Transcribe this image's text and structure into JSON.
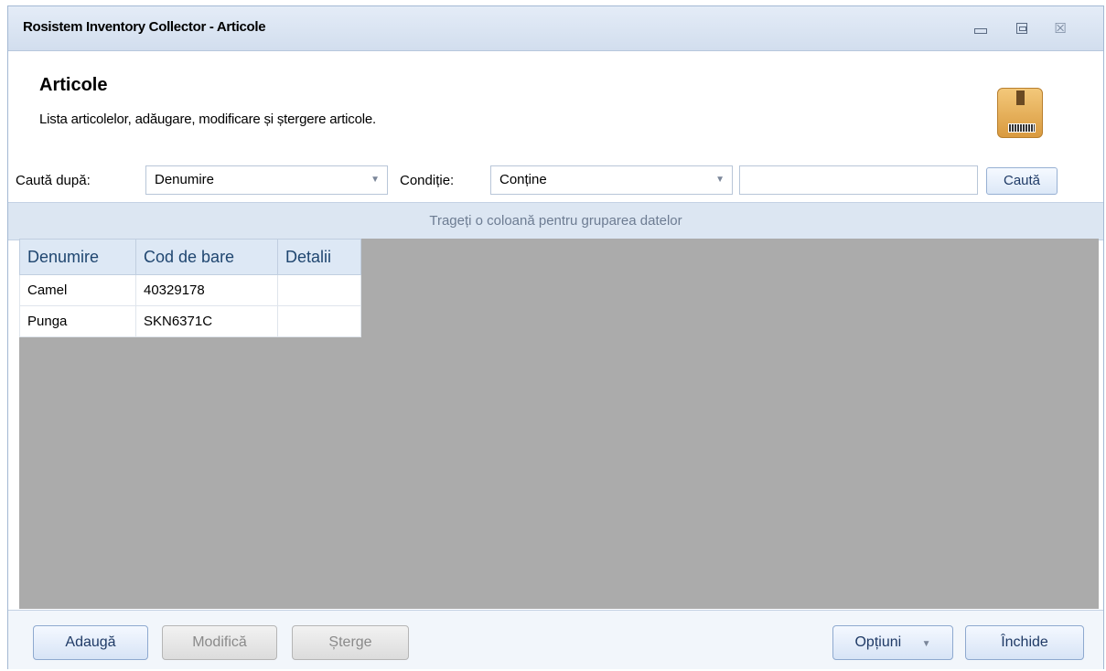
{
  "window": {
    "title": "Rosistem Inventory Collector - Articole",
    "controls": {
      "minimize_icon": "minimize-icon",
      "maximize_icon": "maximize-icon",
      "close_glyph": "☒"
    }
  },
  "header": {
    "title": "Articole",
    "subtitle": "Lista articolelor, adăugare, modificare și ștergere articole.",
    "icon": "package-icon"
  },
  "search": {
    "search_by_label": "Caută după:",
    "search_by_value": "Denumire",
    "condition_label": "Condiție:",
    "condition_value": "Conține",
    "text_value": "",
    "button_label": "Caută"
  },
  "grid": {
    "group_hint": "Trageți o coloană pentru gruparea datelor",
    "columns": [
      "Denumire",
      "Cod de bare",
      "Detalii"
    ],
    "rows": [
      [
        "Camel",
        "40329178",
        ""
      ],
      [
        "Punga",
        "SKN6371C",
        ""
      ]
    ]
  },
  "footer": {
    "add_label": "Adaugă",
    "edit_label": "Modifică",
    "delete_label": "Șterge",
    "options_label": "Opțiuni",
    "close_label": "Închide"
  },
  "colors": {
    "accent": "#1f3a66",
    "grid_background": "#ababab",
    "header_bar": "#d2deee"
  }
}
